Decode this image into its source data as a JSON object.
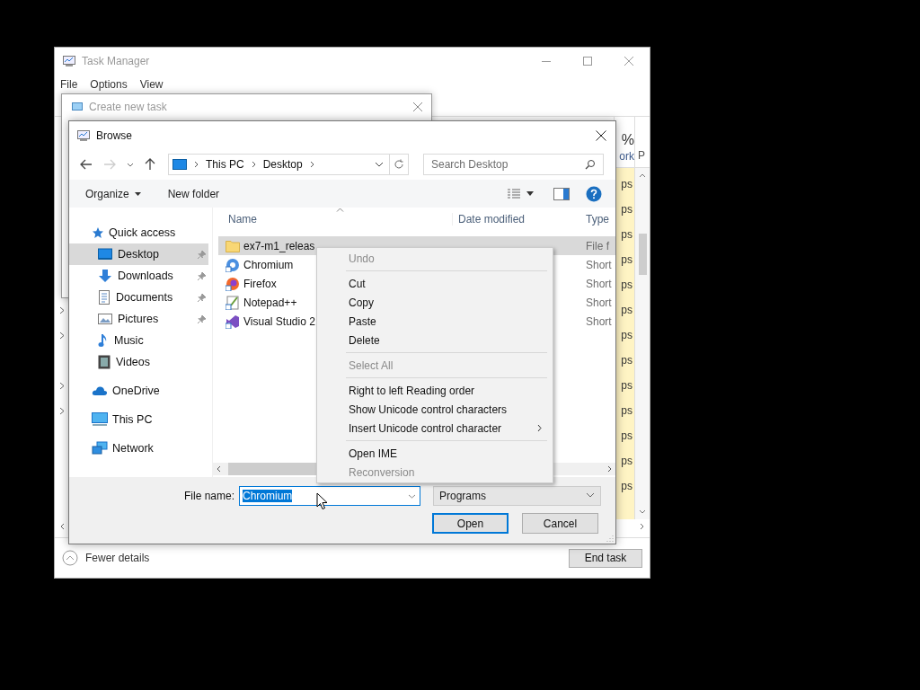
{
  "task_manager": {
    "title": "Task Manager",
    "menu": [
      "File",
      "Options",
      "View"
    ],
    "column_1": {
      "value": "%",
      "label": "ork"
    },
    "column_2": {
      "label": "P"
    },
    "rows": [
      {
        "cell": "ps"
      },
      {
        "cell": "ps"
      },
      {
        "cell": "ps"
      },
      {
        "cell": "ps"
      },
      {
        "cell": "ps"
      },
      {
        "cell": "ps"
      },
      {
        "cell": "ps"
      },
      {
        "cell": "ps"
      },
      {
        "cell": "ps"
      },
      {
        "cell": "ps"
      },
      {
        "cell": "ps"
      },
      {
        "cell": "ps"
      },
      {
        "cell": "ps"
      }
    ],
    "visible_row_expanders": [
      {
        "expandable": true
      },
      {
        "expandable": true
      },
      {
        "expandable": false
      },
      {
        "expandable": true
      },
      {
        "expandable": true
      },
      {
        "expandable": false
      },
      {
        "expandable": false
      },
      {
        "expandable": false
      }
    ],
    "footer": {
      "toggle": "Fewer details",
      "button": "End task"
    }
  },
  "create_task": {
    "title": "Create new task"
  },
  "browse": {
    "title": "Browse",
    "address": [
      "This PC",
      "Desktop"
    ],
    "search": {
      "placeholder": "Search Desktop"
    },
    "toolbar": {
      "organize": "Organize",
      "new_folder": "New folder"
    },
    "nav": [
      {
        "label": "Quick access",
        "kind": "star",
        "selected": false,
        "children": [
          {
            "label": "Desktop",
            "kind": "desktop",
            "selected": true,
            "pinned": true
          },
          {
            "label": "Downloads",
            "kind": "download",
            "selected": false,
            "pinned": true
          },
          {
            "label": "Documents",
            "kind": "document",
            "selected": false,
            "pinned": true
          },
          {
            "label": "Pictures",
            "kind": "picture",
            "selected": false,
            "pinned": true
          },
          {
            "label": "Music",
            "kind": "music",
            "selected": false,
            "pinned": false
          },
          {
            "label": "Videos",
            "kind": "video",
            "selected": false,
            "pinned": false
          }
        ]
      },
      {
        "label": "OneDrive",
        "kind": "cloud",
        "selected": false
      },
      {
        "label": "This PC",
        "kind": "pc",
        "selected": false
      },
      {
        "label": "Network",
        "kind": "network",
        "selected": false
      }
    ],
    "columns": [
      "Name",
      "Date modified",
      "Type"
    ],
    "files": [
      {
        "name": "ex7-m1_releas",
        "type": "File f",
        "kind": "folder",
        "selected": true
      },
      {
        "name": "Chromium",
        "type": "Short",
        "kind": "chromium",
        "selected": false
      },
      {
        "name": "Firefox",
        "type": "Short",
        "kind": "firefox",
        "selected": false
      },
      {
        "name": "Notepad++",
        "type": "Short",
        "kind": "notepad",
        "selected": false
      },
      {
        "name": "Visual Studio 2",
        "type": "Short",
        "kind": "vs",
        "selected": false
      }
    ],
    "file_name": {
      "label": "File name:",
      "value": "Chromium"
    },
    "file_type": "Programs",
    "buttons": [
      {
        "label": "Open",
        "default": true
      },
      {
        "label": "Cancel",
        "default": false
      }
    ]
  },
  "context_menu": [
    {
      "kind": "item",
      "label": "Undo",
      "disabled": true,
      "submenu": false
    },
    {
      "kind": "separator"
    },
    {
      "kind": "item",
      "label": "Cut",
      "disabled": false,
      "submenu": false
    },
    {
      "kind": "item",
      "label": "Copy",
      "disabled": false,
      "submenu": false
    },
    {
      "kind": "item",
      "label": "Paste",
      "disabled": false,
      "submenu": false
    },
    {
      "kind": "item",
      "label": "Delete",
      "disabled": false,
      "submenu": false
    },
    {
      "kind": "separator"
    },
    {
      "kind": "item",
      "label": "Select All",
      "disabled": true,
      "submenu": false
    },
    {
      "kind": "separator"
    },
    {
      "kind": "item",
      "label": "Right to left Reading order",
      "disabled": false,
      "submenu": false
    },
    {
      "kind": "item",
      "label": "Show Unicode control characters",
      "disabled": false,
      "submenu": false
    },
    {
      "kind": "item",
      "label": "Insert Unicode control character",
      "disabled": false,
      "submenu": true
    },
    {
      "kind": "separator"
    },
    {
      "kind": "item",
      "label": "Open IME",
      "disabled": false,
      "submenu": false
    },
    {
      "kind": "item",
      "label": "Reconversion",
      "disabled": true,
      "submenu": false
    }
  ]
}
